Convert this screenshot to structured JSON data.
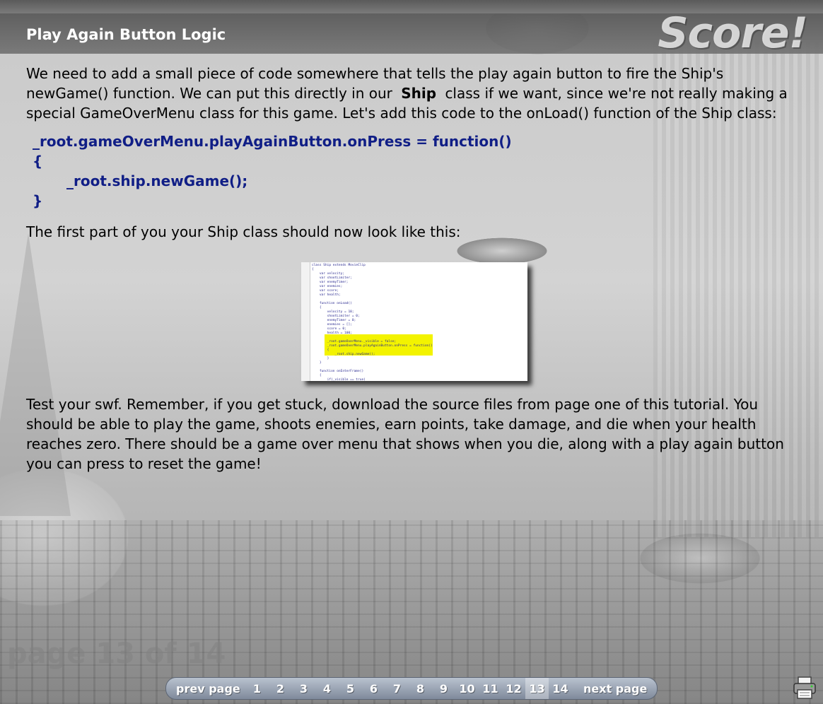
{
  "header": {
    "title": "Play Again Button Logic",
    "brand": "Score!"
  },
  "intro": {
    "line1": "We need to add a small piece of code somewhere that tells the play again button to fire the Ship's",
    "line2_pre": "newGame() function. We can put this directly in our",
    "line2_bold": "Ship",
    "line2_post": "class if we want, since we're not really making a",
    "line3": "special GameOverMenu class for this game. Let's add this code to the onLoad() function of the Ship class:"
  },
  "code": {
    "line1": "_root.gameOverMenu.playAgainButton.onPress = function()",
    "line2": "{",
    "line3": "_root.ship.newGame();",
    "line4": "}"
  },
  "after_code": "The first part of you your Ship class should now look like this:",
  "thumbnail": {
    "lines": [
      "class Ship extends MovieClip",
      "{",
      "    var velocity;",
      "    var shootLimiter;",
      "    var enemyTimer;",
      "    var enemies;",
      "    var score;",
      "    var health;",
      "",
      "    function onLoad()",
      "    {",
      "        velocity = 10;",
      "        shootLimiter = 0;",
      "        enemyTimer = 0;",
      "        enemies = [];",
      "        score = 0;",
      "        health = 100;",
      "",
      "        _root.gameOverMenu._visible = false;",
      "        _root.gameOverMenu.playAgainButton.onPress = function()",
      "        {",
      "            _root.ship.newGame();",
      "        }",
      "    }",
      "",
      "    function onEnterFrame()",
      "    {",
      "        if(_visible == true)",
      "        {"
    ],
    "highlight_color": "#f3f300"
  },
  "closing": "Test your swf. Remember, if you get stuck, download the source files from page one of this tutorial. You should be able to play the game, shoots enemies, earn points, take damage, and die when your health reaches zero. There should be a game over menu that shows when you die, along with a play again button you can press to reset the game!",
  "page_label": "page 13 of 14",
  "nav": {
    "prev": "prev page",
    "next": "next page",
    "pages": [
      "1",
      "2",
      "3",
      "4",
      "5",
      "6",
      "7",
      "8",
      "9",
      "10",
      "11",
      "12",
      "13",
      "14"
    ],
    "active": "13"
  },
  "colors": {
    "code": "#101e86",
    "title_bar": "#6f6f6f",
    "nav_bar": "#9aa3b1"
  },
  "icons": {
    "print": "printer-icon"
  }
}
